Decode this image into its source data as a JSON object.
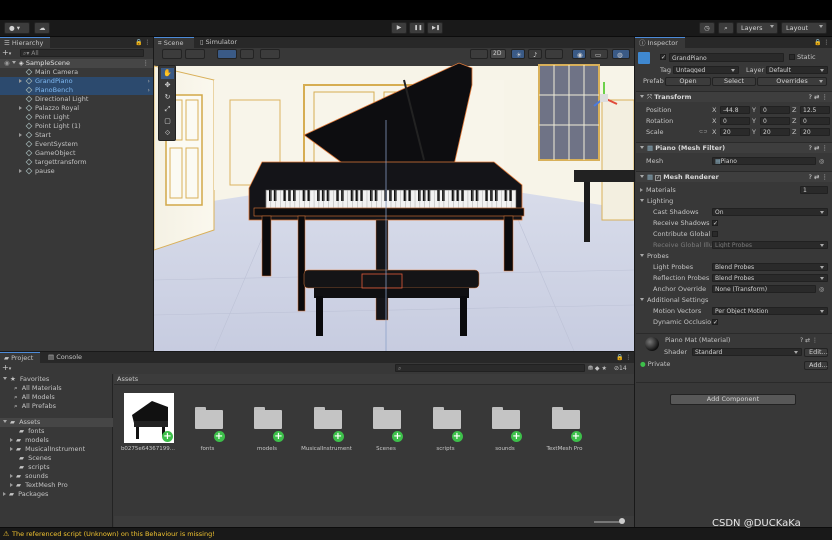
{
  "toolbar": {
    "account_label": "▾",
    "cloud_label": "☁",
    "play": "▶",
    "pause": "❚❚",
    "step": "▶❚",
    "layers": "Layers",
    "layout": "Layout"
  },
  "hierarchy": {
    "tab": "Hierarchy",
    "search_placeholder": "All",
    "scene": "SampleScene",
    "items": [
      {
        "label": "Main Camera",
        "selected": false,
        "expand": false
      },
      {
        "label": "GrandPiano",
        "selected": true,
        "expand": true
      },
      {
        "label": "PianoBench",
        "selected": true,
        "expand": false
      },
      {
        "label": "Directional Light",
        "selected": false,
        "expand": false
      },
      {
        "label": "Palazzo Royal",
        "selected": false,
        "expand": true
      },
      {
        "label": "Point Light",
        "selected": false,
        "expand": false
      },
      {
        "label": "Point Light (1)",
        "selected": false,
        "expand": false
      },
      {
        "label": "Start",
        "selected": false,
        "expand": true
      },
      {
        "label": "EventSystem",
        "selected": false,
        "expand": false
      },
      {
        "label": "GameObject",
        "selected": false,
        "expand": false
      },
      {
        "label": "targettransform",
        "selected": false,
        "expand": false
      },
      {
        "label": "pause",
        "selected": false,
        "expand": true
      }
    ]
  },
  "scene": {
    "tab_scene": "Scene",
    "tab_simulator": "Simulator",
    "mode_2d": "2D"
  },
  "inspector": {
    "tab": "Inspector",
    "object_name": "GrandPiano",
    "static_label": "Static",
    "tag_label": "Tag",
    "tag_value": "Untagged",
    "layer_label": "Layer",
    "layer_value": "Default",
    "prefab_label": "Prefab",
    "prefab_open": "Open",
    "prefab_select": "Select",
    "prefab_overrides": "Overrides",
    "transform": {
      "title": "Transform",
      "position_label": "Position",
      "rotation_label": "Rotation",
      "scale_label": "Scale",
      "position": [
        "-44.8",
        "0",
        "12.5"
      ],
      "rotation": [
        "0",
        "0",
        "0"
      ],
      "scale": [
        "20",
        "20",
        "20"
      ]
    },
    "mesh_filter": {
      "title": "Piano (Mesh Filter)",
      "mesh_label": "Mesh",
      "mesh_value": "Piano"
    },
    "mesh_renderer": {
      "title": "Mesh Renderer",
      "materials_label": "Materials",
      "materials_count": "1",
      "lighting_label": "Lighting",
      "cast_shadows_label": "Cast Shadows",
      "cast_shadows_value": "On",
      "receive_shadows_label": "Receive Shadows",
      "contribute_gi_label": "Contribute Global I",
      "receive_gi_label": "Receive Global Illu",
      "receive_gi_value": "Light Probes",
      "probes_label": "Probes",
      "light_probes_label": "Light Probes",
      "light_probes_value": "Blend Probes",
      "reflection_probes_label": "Reflection Probes",
      "reflection_probes_value": "Blend Probes",
      "anchor_override_label": "Anchor Override",
      "anchor_override_value": "None (Transform)",
      "additional_label": "Additional Settings",
      "motion_vectors_label": "Motion Vectors",
      "motion_vectors_value": "Per Object Motion",
      "dynamic_occlusion_label": "Dynamic Occlusio"
    },
    "material": {
      "title": "Piano Mat (Material)",
      "shader_label": "Shader",
      "shader_value": "Standard",
      "edit_label": "Edit...",
      "private_label": "Private",
      "add_label": "Add..."
    },
    "add_component": "Add Component"
  },
  "project": {
    "tab_project": "Project",
    "tab_console": "Console",
    "favorites_label": "Favorites",
    "favorites": [
      "All Materials",
      "All Models",
      "All Prefabs"
    ],
    "assets_label": "Assets",
    "asset_folders": [
      "fonts",
      "models",
      "MusicalInstrument",
      "Scenes",
      "scripts",
      "sounds",
      "TextMesh Pro"
    ],
    "packages_label": "Packages",
    "breadcrumb": "Assets",
    "count_label": "14",
    "grid_items": [
      "b0275e64367199...",
      "fonts",
      "models",
      "MusicalInstrument",
      "Scenes",
      "scripts",
      "sounds",
      "TextMesh Pro"
    ]
  },
  "status": {
    "message": "The referenced script (Unknown) on this Behaviour is missing!"
  },
  "watermark": "CSDN @DUCKaKa"
}
